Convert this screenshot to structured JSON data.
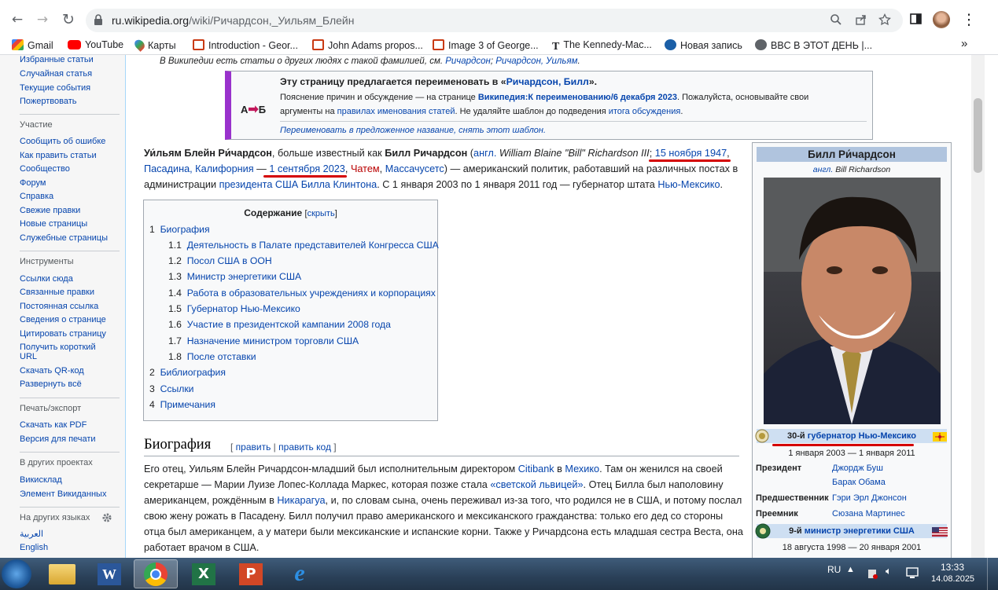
{
  "browser": {
    "url_host": "ru.wikipedia.org",
    "url_path": "/wiki/Ричардсон,_Уильям_Блейн",
    "back_glyph": "←",
    "forward_glyph": "→",
    "reload_glyph": "↻",
    "menu_glyph": "⋮",
    "bookmarks": [
      {
        "label": "Gmail",
        "icon": "gmail-icon"
      },
      {
        "label": "YouTube",
        "icon": "youtube-icon"
      },
      {
        "label": "Карты",
        "icon": "maps-icon"
      },
      {
        "label": "Introduction - Geor...",
        "icon": "doc-icon"
      },
      {
        "label": "John Adams propos...",
        "icon": "doc-icon"
      },
      {
        "label": "Image 3 of George...",
        "icon": "doc-icon"
      },
      {
        "label": "The Kennedy-Mac...",
        "icon": "nyt-icon"
      },
      {
        "label": "Новая запись",
        "icon": "bookmark-icon"
      },
      {
        "label": "BBC В ЭТОТ ДЕНЬ |...",
        "icon": "globe-icon"
      }
    ],
    "bookmarks_more": "»"
  },
  "sidebar": {
    "nav": [
      "Избранные статьи",
      "Случайная статья",
      "Текущие события",
      "Пожертвовать"
    ],
    "participation_title": "Участие",
    "participation": [
      "Сообщить об ошибке",
      "Как править статьи",
      "Сообщество",
      "Форум",
      "Справка",
      "Свежие правки",
      "Новые страницы",
      "Служебные страницы"
    ],
    "tools_title": "Инструменты",
    "tools": [
      "Ссылки сюда",
      "Связанные правки",
      "Постоянная ссылка",
      "Сведения о странице",
      "Цитировать страницу",
      "Получить короткий",
      "URL",
      "Скачать QR-код",
      "Развернуть всё"
    ],
    "print_title": "Печать/экспорт",
    "print": [
      "Скачать как PDF",
      "Версия для печати"
    ],
    "projects_title": "В других проектах",
    "projects": [
      "Викисклад",
      "Элемент Викиданных"
    ],
    "languages_title": "На других языках",
    "languages": [
      "العربية",
      "English"
    ]
  },
  "article": {
    "hatnote_a": "В Википедии есть статьи о других людях с такой фамилией, см. ",
    "hatnote_link1": "Ричардсон",
    "hatnote_sep": "; ",
    "hatnote_link2": "Ричардсон, Уильям",
    "hatnote_end": ".",
    "mbox": {
      "icon_text": "А",
      "icon_text2": "Б",
      "title_a": "Эту страницу предлагается переименовать в «",
      "title_link": "Ричардсон, Билл",
      "title_b": "».",
      "l1_a": "Пояснение причин и обсуждение — на странице ",
      "l1_link": "Википедия:К переименованию/6 декабря 2023",
      "l1_b": ". Пожалуйста, основывайте свои",
      "l2_a": "аргументы на ",
      "l2_link": "правилах именования статей",
      "l2_b": ". Не удаляйте шаблон до подведения ",
      "l2_link2": "итога обсуждения",
      "l2_c": ".",
      "footer": "Переименовать в предложенное название, снять этот шаблон."
    },
    "intro": {
      "bold1": "Уи́льям Блейн Ри́чардсон",
      "t1": ", больше известный как ",
      "bold2": "Билл Ричардсон",
      "t2": " (",
      "lang": "англ.",
      "orig": " William Blaine \"Bill\" Richardson III",
      "t3": "; ",
      "born": "15 ноября 1947",
      "comma": ",",
      "place": "Пасадина, Калифорния",
      "dash": " — ",
      "died": "1 сентября 2023",
      "comma2": ", ",
      "chatham": "Чатем",
      "comma3": ", ",
      "mass": "Массачусетс",
      "t4": ") — американский политик, работавший на различных постах в",
      "t5": "администрации ",
      "pres_link": "президента США Билла Клинтона",
      "t6": ". С 1 января 2003 по 1 января 2011 год — губернатор штата ",
      "nm_link": "Нью-Мексико",
      "t7": "."
    },
    "toc": {
      "title": "Содержание",
      "hide": "скрыть",
      "items": [
        {
          "num": "1",
          "label": "Биография",
          "level": 1
        },
        {
          "num": "1.1",
          "label": "Деятельность в Палате представителей Конгресса США",
          "level": 2
        },
        {
          "num": "1.2",
          "label": "Посол США в ООН",
          "level": 2
        },
        {
          "num": "1.3",
          "label": "Министр энергетики США",
          "level": 2
        },
        {
          "num": "1.4",
          "label": "Работа в образовательных учреждениях и корпорациях",
          "level": 2
        },
        {
          "num": "1.5",
          "label": "Губернатор Нью-Мексико",
          "level": 2
        },
        {
          "num": "1.6",
          "label": "Участие в президентской кампании 2008 года",
          "level": 2
        },
        {
          "num": "1.7",
          "label": "Назначение министром торговли США",
          "level": 2
        },
        {
          "num": "1.8",
          "label": "После отставки",
          "level": 2
        },
        {
          "num": "2",
          "label": "Библиография",
          "level": 1
        },
        {
          "num": "3",
          "label": "Ссылки",
          "level": 1
        },
        {
          "num": "4",
          "label": "Примечания",
          "level": 1
        }
      ]
    },
    "section_title": "Биография",
    "section_edit": "править",
    "section_edit_code": "править код",
    "bio": {
      "l1_a": "Его отец, Уильям Блейн Ричардсон-младший был исполнительным директором ",
      "l1_link": "Citibank",
      "l1_b": " в ",
      "l1_link2": "Мехико",
      "l1_c": ". Там он женился на своей",
      "l2_a": "секретарше — Марии Луизе Лопес-Коллада Маркес, которая позже стала ",
      "l2_link": "«светской львицей»",
      "l2_b": ". Отец Билла был наполовину",
      "l3_a": "американцем, рождённым в ",
      "l3_link": "Никарагуа",
      "l3_b": ", и, по словам сына, очень переживал из-за того, что родился не в США, и потому послал",
      "l4": "свою жену рожать в Пасадену. Билл получил право американского и мексиканского гражданства: только его дед со стороны",
      "l5": "отца был американцем, а у матери были мексиканские и испанские корни. Также у Ричардсона есть младшая сестра Веста, она",
      "l6": "работает врачом в США."
    },
    "infobox": {
      "title": "Билл Ри́чардсон",
      "sub_lang": "англ.",
      "sub_name": " Bill Richardson",
      "office1_a": "30-й ",
      "office1_link": "губернатор Нью-Мексико",
      "office1_dates": "1 января 2003 — 1 января 2011",
      "president_label": "Президент",
      "presidents": [
        "Джордж Буш",
        "Барак Обама"
      ],
      "predecessor_label": "Предшественник",
      "predecessor": "Гэри Эрл Джонсон",
      "successor_label": "Преемник",
      "successor": "Сюзана Мартинес",
      "office2_a": "9-й ",
      "office2_link": "министр энергетики США",
      "office2_dates": "18 августа 1998 — 20 января 2001"
    }
  },
  "taskbar": {
    "lang": "RU",
    "time": "13:33",
    "date": "14.08.2025",
    "apps": [
      "Windows Explorer",
      "Microsoft Word",
      "Google Chrome",
      "Microsoft Excel",
      "Microsoft PowerPoint",
      "Internet Explorer"
    ]
  },
  "colors": {
    "link": "#0645ad",
    "redlink": "#ba0000",
    "annotation": "#d40000",
    "mbox_accent": "#9932cc"
  }
}
